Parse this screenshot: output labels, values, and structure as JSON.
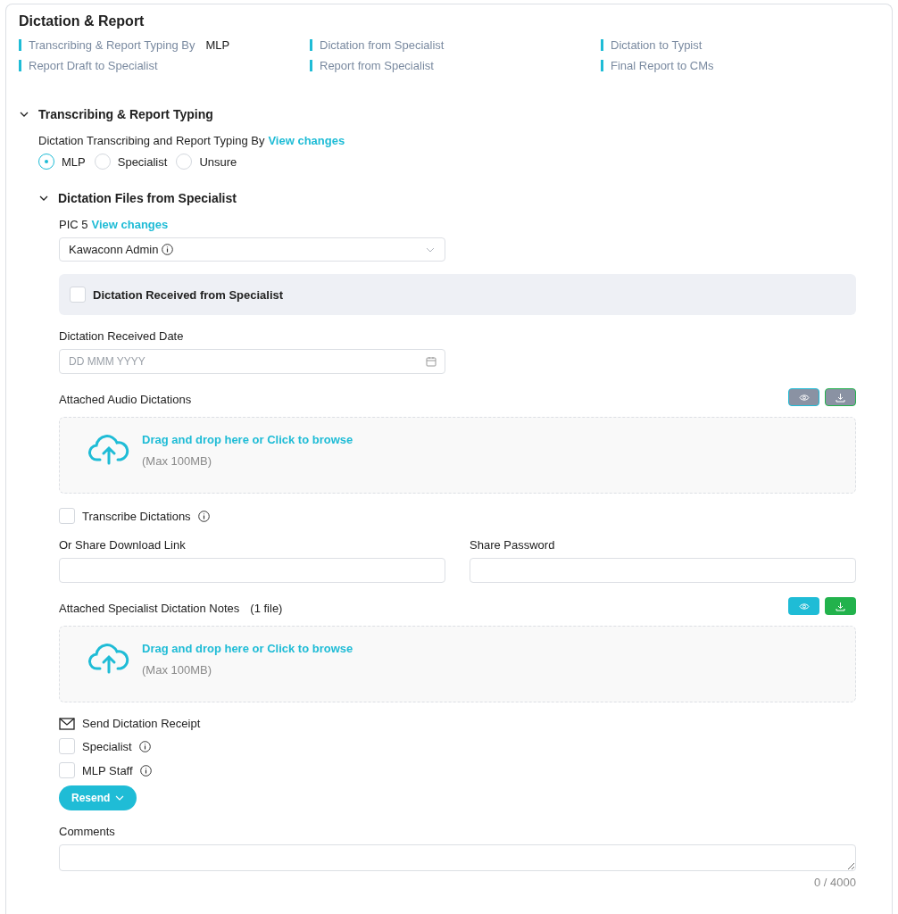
{
  "title": "Dictation & Report",
  "summary": [
    {
      "label": "Transcribing & Report Typing By",
      "value": "MLP"
    },
    {
      "label": "Dictation from Specialist"
    },
    {
      "label": "Dictation to Typist"
    },
    {
      "label": "Report Draft to Specialist"
    },
    {
      "label": "Report from Specialist"
    },
    {
      "label": "Final Report to CMs"
    }
  ],
  "section": {
    "title": "Transcribing & Report Typing",
    "expanded": true,
    "typing_by": {
      "label": "Dictation Transcribing and Report Typing By",
      "link": "View changes",
      "options": [
        {
          "label": "MLP",
          "selected": true
        },
        {
          "label": "Specialist",
          "selected": false
        },
        {
          "label": "Unsure",
          "selected": false
        }
      ]
    },
    "subsection": {
      "title": "Dictation Files from Specialist",
      "expanded": true,
      "pic": {
        "label": "PIC 5",
        "link": "View changes",
        "value": "Kawaconn Admin"
      },
      "received": {
        "label": "Dictation Received from Specialist",
        "checked": false
      },
      "date": {
        "label": "Dictation Received Date",
        "placeholder": "DD MMM YYYY"
      },
      "audio": {
        "label": "Attached Audio Dictations",
        "disabled": true,
        "drop_text": "Drag and drop here or Click to browse",
        "limit": "(Max 100MB)"
      },
      "transcribe": {
        "label": "Transcribe Dictations",
        "checked": false
      },
      "link_field": {
        "label": "Or Share Download Link"
      },
      "password_field": {
        "label": "Share Password"
      },
      "notes": {
        "label": "Attached Specialist Dictation Notes",
        "count": "(1 file)",
        "disabled": false,
        "drop_text": "Drag and drop here or Click to browse",
        "limit": "(Max 100MB)"
      },
      "receipt": {
        "title": "Send Dictation Receipt",
        "recipients": [
          {
            "label": "Specialist",
            "checked": false
          },
          {
            "label": "MLP Staff",
            "checked": false
          }
        ]
      },
      "resend": "Resend",
      "comments": {
        "label": "Comments",
        "counter": "0 / 4000"
      }
    }
  }
}
